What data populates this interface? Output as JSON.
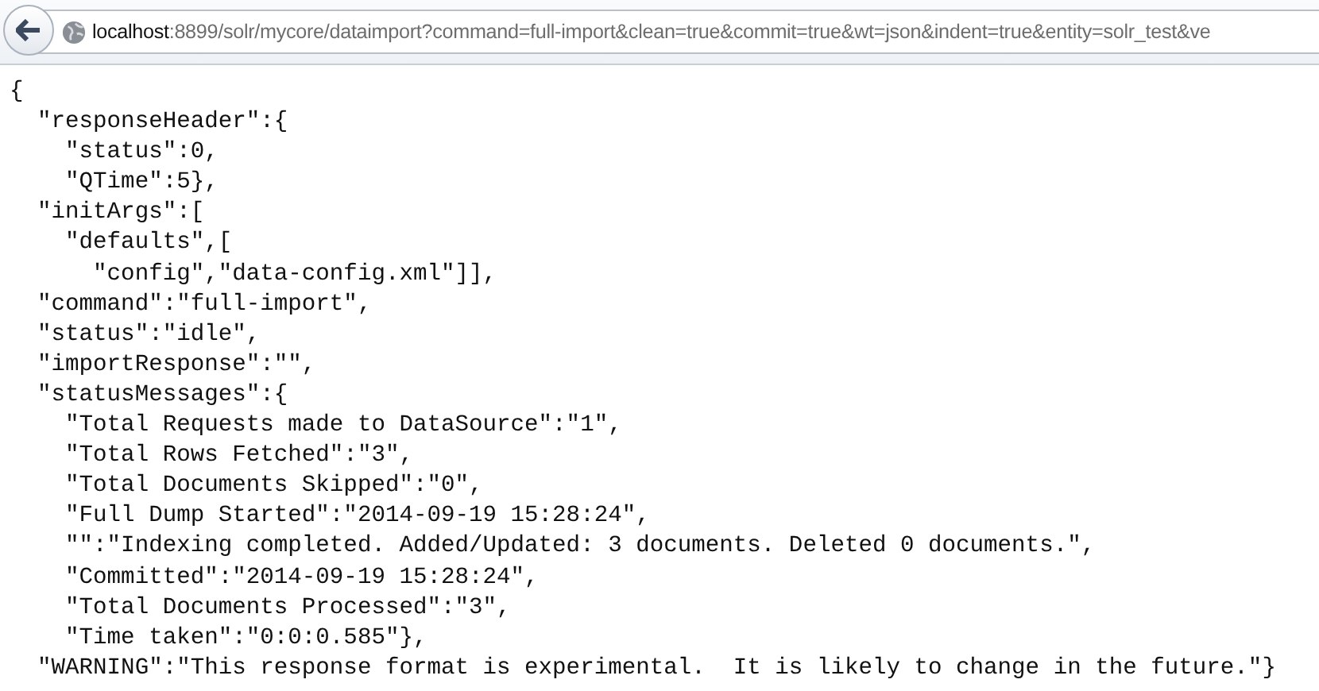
{
  "address_bar": {
    "host": "localhost",
    "rest": ":8899/solr/mycore/dataimport?command=full-import&clean=true&commit=true&wt=json&indent=true&entity=solr_test&ve"
  },
  "document": {
    "lines": [
      "{",
      "  \"responseHeader\":{",
      "    \"status\":0,",
      "    \"QTime\":5},",
      "  \"initArgs\":[",
      "    \"defaults\",[",
      "      \"config\",\"data-config.xml\"]],",
      "  \"command\":\"full-import\",",
      "  \"status\":\"idle\",",
      "  \"importResponse\":\"\",",
      "  \"statusMessages\":{",
      "    \"Total Requests made to DataSource\":\"1\",",
      "    \"Total Rows Fetched\":\"3\",",
      "    \"Total Documents Skipped\":\"0\",",
      "    \"Full Dump Started\":\"2014-09-19 15:28:24\",",
      "    \"\":\"Indexing completed. Added/Updated: 3 documents. Deleted 0 documents.\",",
      "    \"Committed\":\"2014-09-19 15:28:24\",",
      "    \"Total Documents Processed\":\"3\",",
      "    \"Time taken\":\"0:0:0.585\"},",
      "  \"WARNING\":\"This response format is experimental.  It is likely to change in the future.\"}"
    ]
  }
}
